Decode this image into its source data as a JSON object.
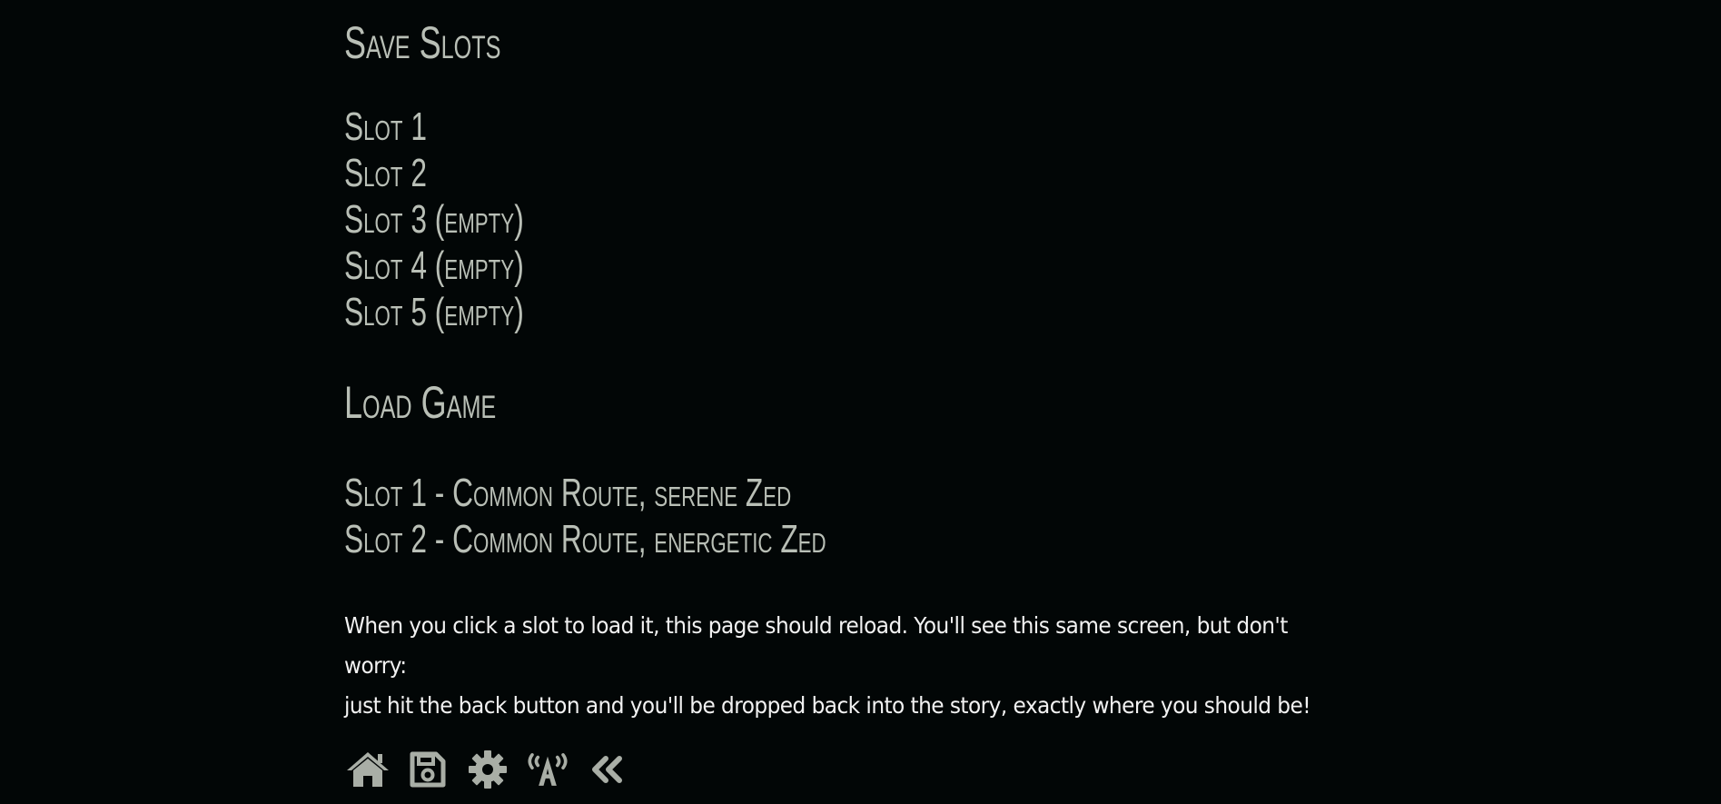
{
  "save_section": {
    "title": "Save Slots",
    "slots": [
      {
        "label": "Slot 1"
      },
      {
        "label": "Slot 2"
      },
      {
        "label": "Slot 3 (empty)"
      },
      {
        "label": "Slot 4 (empty)"
      },
      {
        "label": "Slot 5 (empty)"
      }
    ]
  },
  "load_section": {
    "title": "Load Game",
    "slots": [
      {
        "label": "Slot 1 - Common Route, serene Zed"
      },
      {
        "label": "Slot 2 - Common Route, energetic Zed"
      }
    ]
  },
  "note": {
    "line1": "When you click a slot to load it, this page should reload. You'll see this same screen, but don't worry:",
    "line2": "just hit the back button and you'll be dropped back into the story, exactly where you should be!"
  },
  "toolbar": {
    "icons": [
      "home-icon",
      "save-icon",
      "gear-icon",
      "accessibility-broadcast-icon",
      "double-chevron-left-icon"
    ]
  },
  "colors": {
    "background": "#020606",
    "heading_text": "#b9bfb6",
    "body_text": "#f2f2f2",
    "icon": "#a9aea6"
  }
}
